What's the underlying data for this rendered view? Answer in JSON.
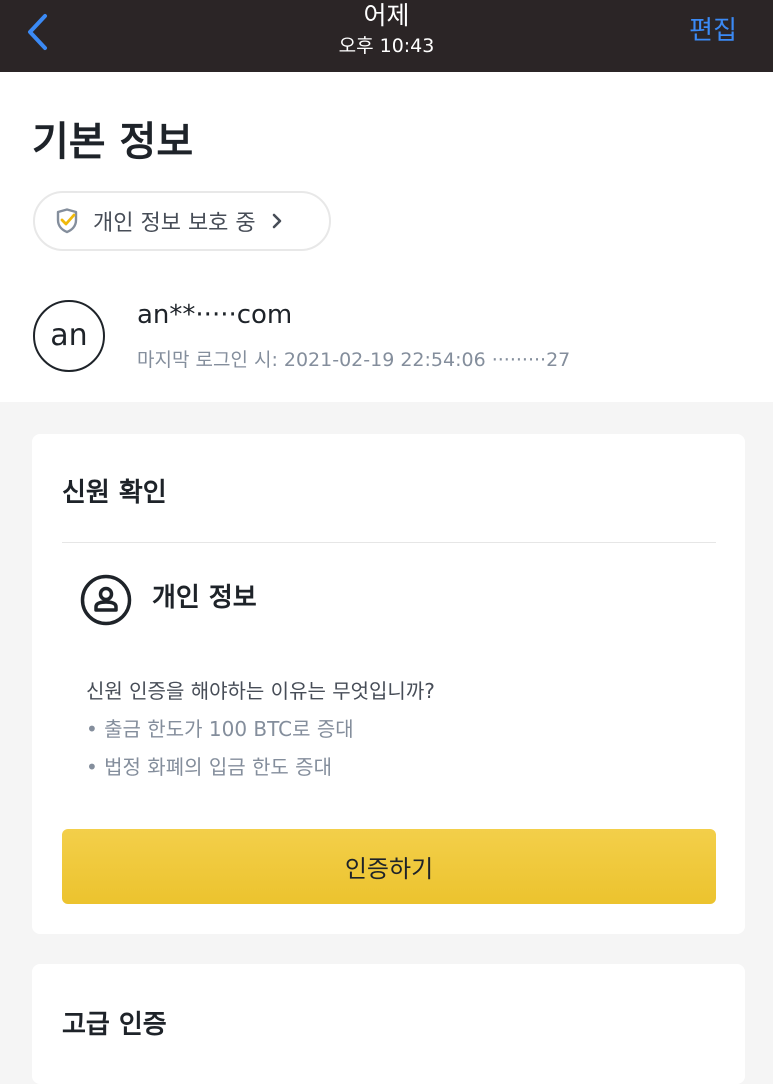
{
  "topbar": {
    "title": "어제",
    "subtitle": "오후 10:43",
    "edit_label": "편집"
  },
  "header": {
    "page_title": "기본 정보",
    "privacy_label": "개인 정보 보호 중"
  },
  "profile": {
    "avatar_text": "an",
    "email": "an**·····com",
    "last_login": "마지막 로그인 시: 2021-02-19 22:54:06 ·········27"
  },
  "identity": {
    "title": "신원 확인",
    "section_label": "개인 정보",
    "reason_title": "신원 인증을 해야하는 이유는 무엇입니까?",
    "bullets": [
      "• 출금 한도가 100 BTC로 증대",
      "• 법정 화폐의 입금 한도 증대"
    ],
    "verify_button": "인증하기"
  },
  "advanced": {
    "title": "고급 인증"
  },
  "colors": {
    "accent": "#f0c53a",
    "link": "#3b8af5",
    "topbar": "#2b2526"
  }
}
